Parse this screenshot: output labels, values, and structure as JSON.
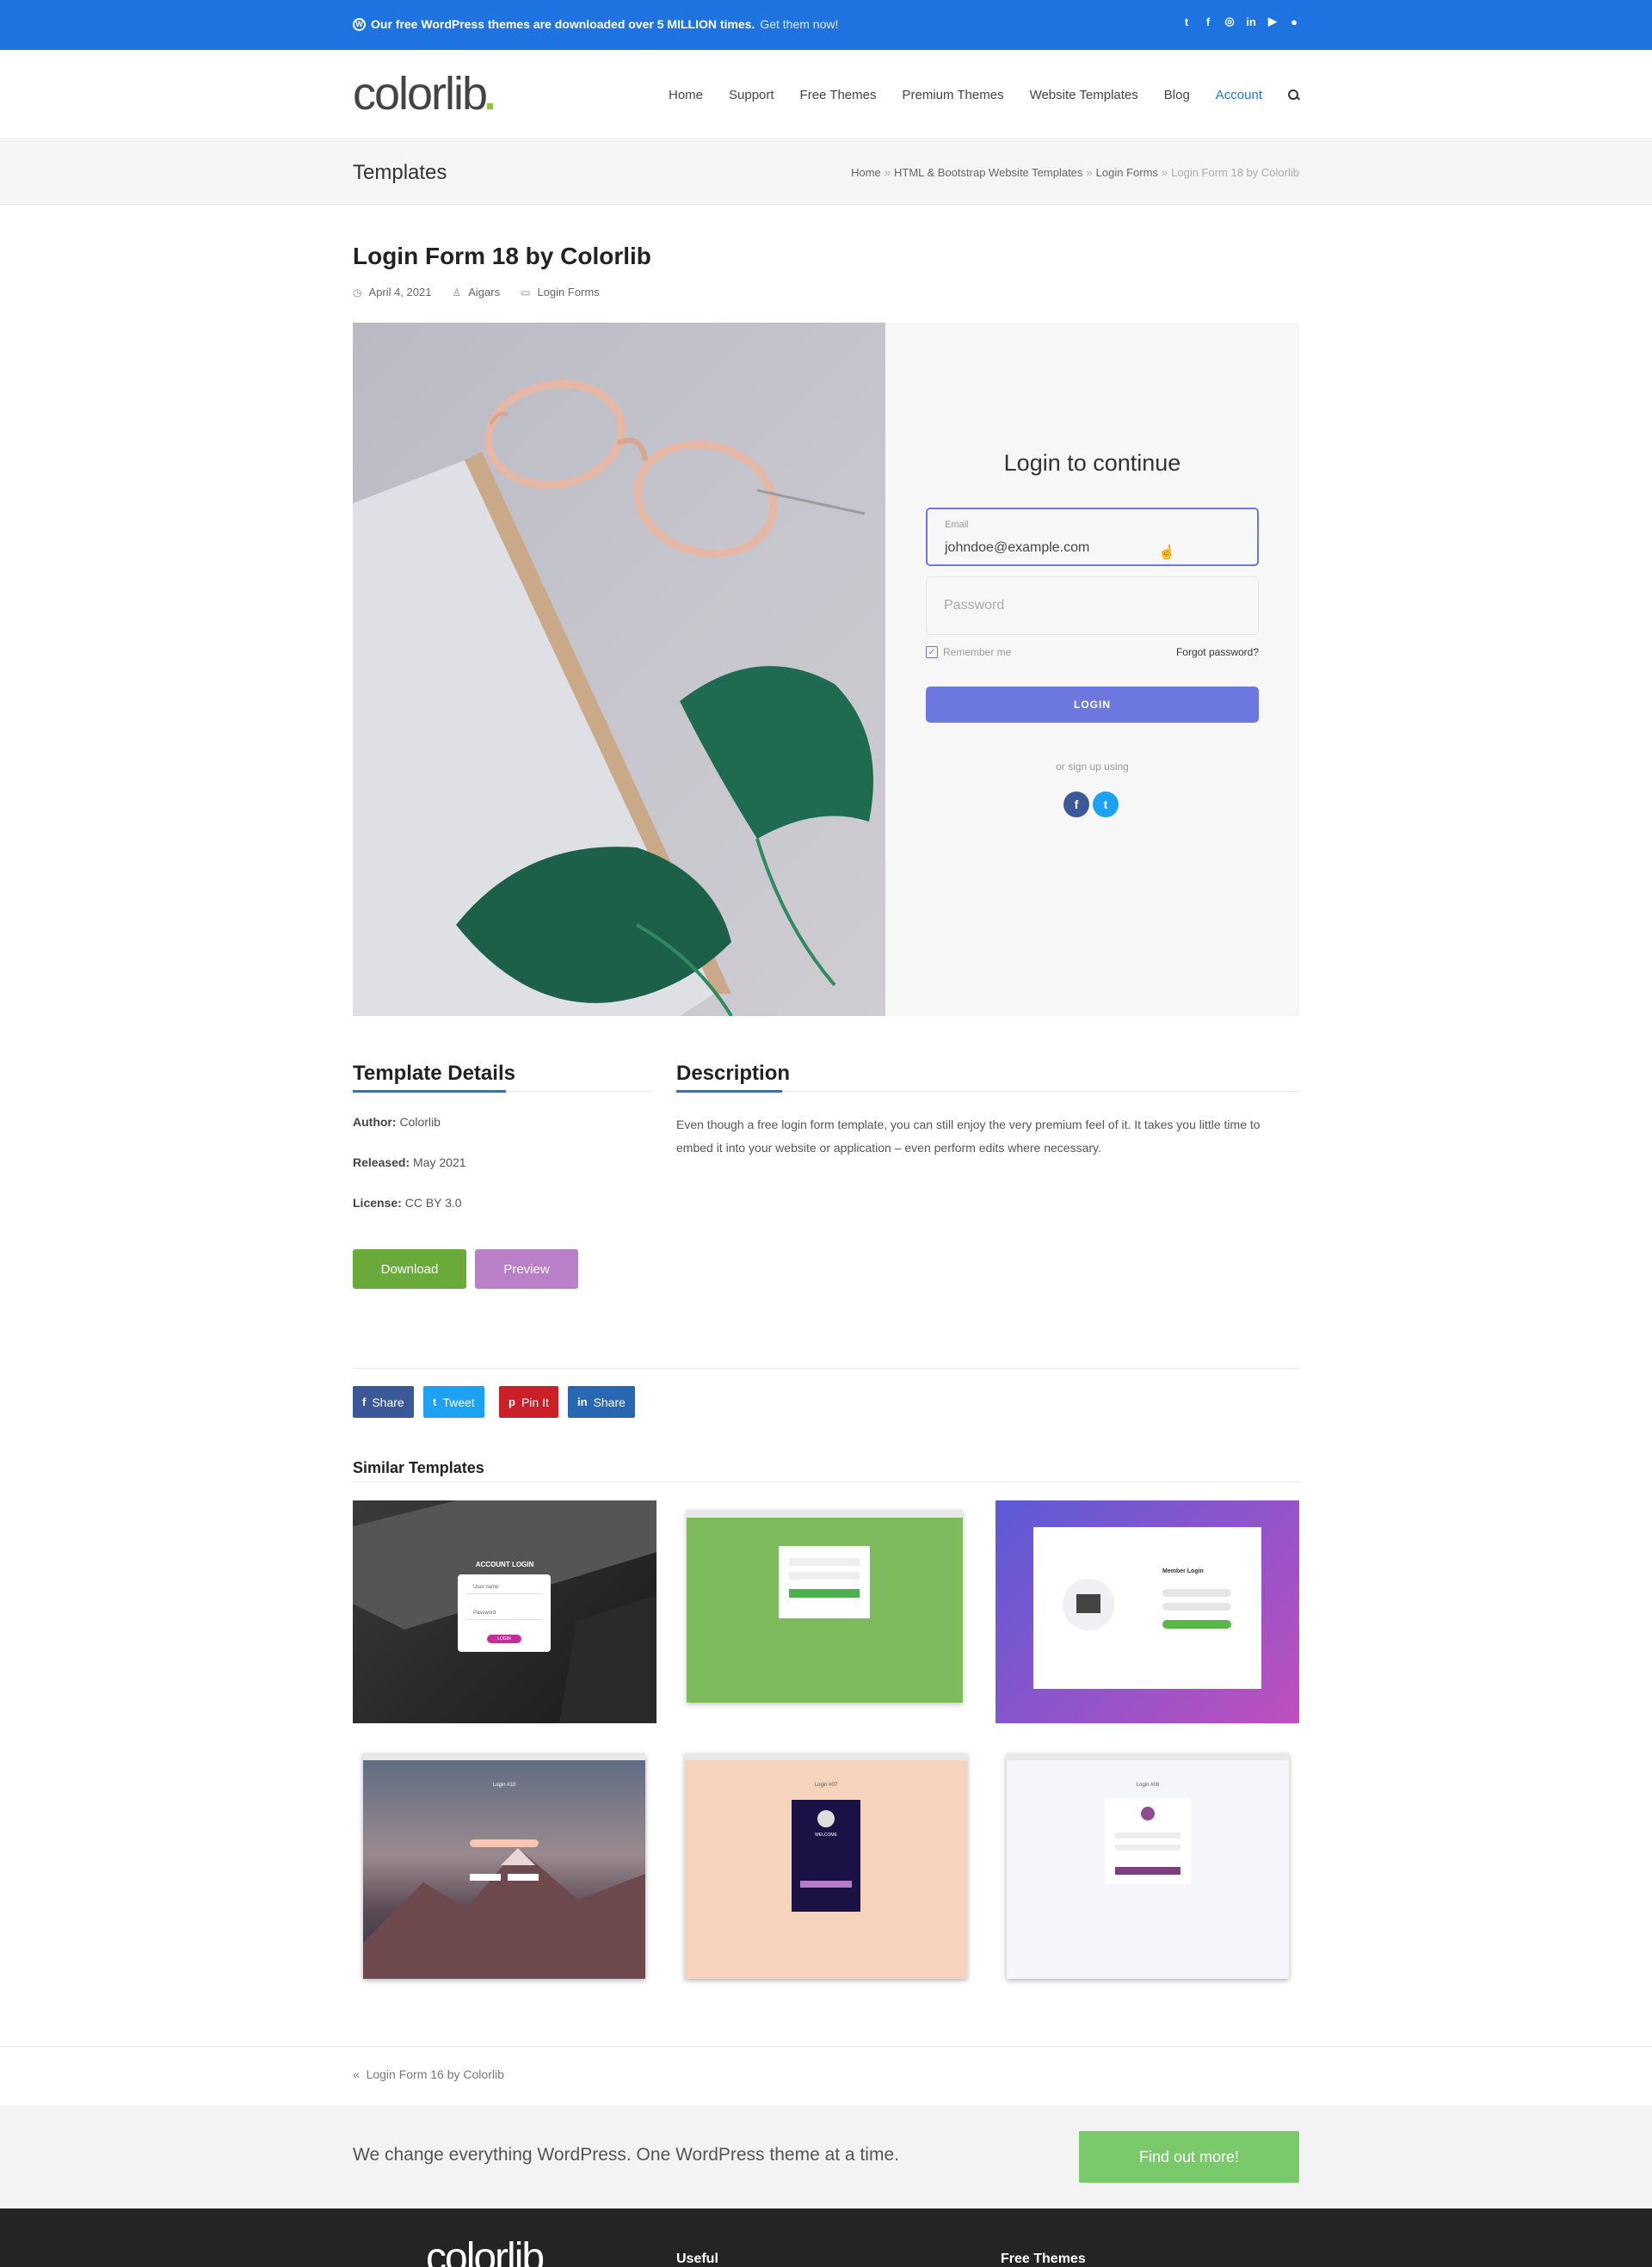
{
  "topbar": {
    "message_bold": "Our free WordPress themes are downloaded over 5 MILLION times.",
    "message_link": "Get them now!",
    "social_icons": [
      "twitter-icon",
      "facebook-icon",
      "instagram-icon",
      "linkedin-icon",
      "youtube-icon",
      "github-icon"
    ]
  },
  "header": {
    "logo": "colorlib",
    "nav": [
      "Home",
      "Support",
      "Free Themes",
      "Premium Themes",
      "Website Templates",
      "Blog",
      "Account"
    ],
    "active_nav": "Account"
  },
  "titlebar": {
    "title": "Templates",
    "breadcrumb": [
      "Home",
      "HTML & Bootstrap Website Templates",
      "Login Forms",
      "Login Form 18 by Colorlib"
    ],
    "separator": "»"
  },
  "post": {
    "title": "Login Form 18 by Colorlib",
    "date": "April 4, 2021",
    "author": "Aigars",
    "category": "Login Forms"
  },
  "preview": {
    "heading": "Login to continue",
    "email_label": "Email",
    "email_value": "johndoe@example.com",
    "password_placeholder": "Password",
    "remember": "Remember me",
    "forgot": "Forgot password?",
    "login_button": "LOGIN",
    "signup_text": "or sign up using",
    "accent": "#6c78e0"
  },
  "details": {
    "heading": "Template Details",
    "author_label": "Author:",
    "author_value": "Colorlib",
    "released_label": "Released:",
    "released_value": "May 2021",
    "license_label": "License:",
    "license_value": "CC BY 3.0",
    "download": "Download",
    "preview": "Preview"
  },
  "description": {
    "heading": "Description",
    "text": "Even though a free login form template, you can still enjoy the very premium feel of it. It takes you little time to embed it into your website or application – even perform edits where necessary."
  },
  "share": [
    {
      "icon": "f",
      "label": "Share",
      "color": "#3b5998"
    },
    {
      "icon": "t",
      "label": "Tweet",
      "color": "#1da1f2"
    },
    {
      "icon": "p",
      "label": "Pin It",
      "color": "#cb2027"
    },
    {
      "icon": "in",
      "label": "Share",
      "color": "#2867b2"
    }
  ],
  "similar": {
    "title": "Similar Templates",
    "thumb_texts": {
      "t1_heading": "ACCOUNT LOGIN",
      "t1_user": "User name",
      "t1_pass": "Password",
      "t1_btn": "LOGIN",
      "t3_heading": "Member Login",
      "t4_heading": "Login #10",
      "t5_heading": "Login #07",
      "t5_welcome": "WELCOME",
      "t6_heading": "Login #08"
    }
  },
  "navigation": {
    "previous": "Login Form 16 by Colorlib"
  },
  "cta": {
    "text": "We change everything WordPress. One WordPress theme at a time.",
    "button": "Find out more!"
  },
  "footer": {
    "logo": "colorlib",
    "col1": "Useful",
    "col2": "Free Themes"
  }
}
